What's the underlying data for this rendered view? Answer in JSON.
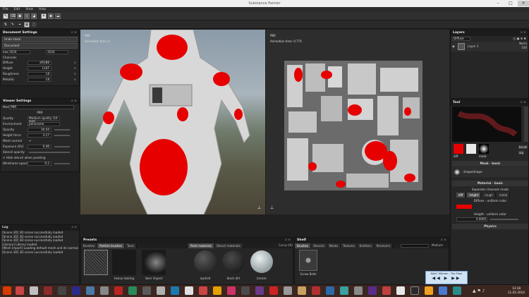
{
  "window": {
    "title": "Substance Painter"
  },
  "menu": [
    "File",
    "Edit",
    "View",
    "Help"
  ],
  "document_settings": {
    "title": "Document Settings",
    "uv_stack_label": "Undo stack",
    "document_label": "Document",
    "size_label": "Size",
    "size_value": "1024",
    "size_value2": "1024",
    "channels_label": "Channels",
    "channels": [
      {
        "name": "Diffuse",
        "value": "sRGB8"
      },
      {
        "name": "Height",
        "value": "L16F"
      },
      {
        "name": "Roughness",
        "value": "L8"
      },
      {
        "name": "Metallic",
        "value": "L8"
      }
    ]
  },
  "viewer_settings": {
    "title": "Viewer Settings",
    "mode_label": "Mode",
    "mode_value": "PBR",
    "pbr_label": "PBR",
    "quality_label": "Quality",
    "quality_value": "Medium quality (16 spp)",
    "environment_label": "Environment",
    "environment_value": "panorama",
    "opacity_label": "Opacity",
    "opacity_value": "34.44",
    "height_force_label": "Height force",
    "height_force_value": "3.17",
    "mesh_normal_label": "Mesh normal",
    "mesh_normal_value": "✔",
    "exposure_label": "Exposure (EV)",
    "exposure_value": "0.46",
    "stencil_opacity_label": "Stencil opacity",
    "hide_stencil_label": "Hide stencil when painting",
    "wireframe_label": "Wireframe opacity",
    "wireframe_value": "0.2"
  },
  "log": {
    "title": "Log",
    "lines": [
      "[Scene 3D] 3D scene successfully loaded",
      "[Scene 3D] 3D scene successfully loaded",
      "[Scene 3D] 3D scene successfully loaded",
      "[Library] Library loaded",
      "[Mesh import] Loading default mesh and its normal",
      "[Scene 3D] 3D scene successfully loaded"
    ]
  },
  "viewport3d": {
    "label": "PBR",
    "anim": "Animation time: 0"
  },
  "viewport2d": {
    "label": "PBR",
    "anim": "Animation time: 0.774"
  },
  "presets": {
    "title": "Presets",
    "tabs": [
      "Brushes",
      "Particle brushes",
      "Tools"
    ],
    "items": [
      {
        "name": ""
      },
      {
        "name": "heavy leaking"
      },
      {
        "name": "laser impact"
      }
    ],
    "material_tabs": [
      "Paint materials",
      "Stencil materials"
    ],
    "curvy_label": "Curvy (lit)",
    "materials": [
      {
        "name": "asphalt"
      },
      {
        "name": "black dirt"
      },
      {
        "name": "bronze"
      }
    ]
  },
  "shelf": {
    "title": "Shelf",
    "tabs": [
      "Brushes",
      "Stencils",
      "Masks",
      "Textures",
      "Emitters",
      "Receivers"
    ],
    "search_placeholder": "",
    "size_label": "Medium",
    "items": [
      {
        "name": "Screw Bolts"
      }
    ]
  },
  "layers": {
    "title": "Layers",
    "channel_value": "Diffuse",
    "opacity_value": "100",
    "mode_value": "Norm",
    "layer_name": "Layer 1"
  },
  "tool": {
    "title": "Tool",
    "diff_label": "diff",
    "mask_label": "mask",
    "brush_label": "brush",
    "alpha_label": "alp",
    "mask_section": "Mask · basic",
    "mask_item": "shape/shape",
    "material_section": "Material · basic",
    "separate_channels_label": "Separate channels mode",
    "channel_tabs": [
      "diff",
      "height",
      "rough",
      "metal"
    ],
    "diffuse_uniform": "Diffuse · uniform color",
    "height_uniform": "Height · uniform color",
    "height_value": "0.0000",
    "physics_label": "Physics"
  },
  "media_player": {
    "title": "Kolo7 Hillman - The Fixer"
  },
  "clock": {
    "time": "13:18",
    "date": "11.05.2014"
  },
  "colors": {
    "accent_red": "#e60000",
    "panel": "#262626"
  }
}
